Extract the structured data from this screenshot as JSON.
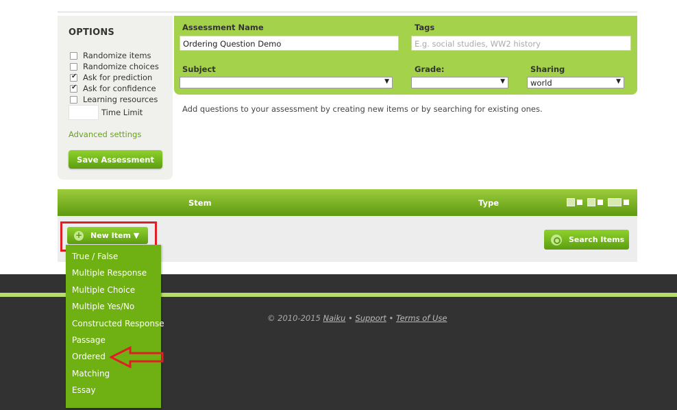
{
  "options": {
    "title": "OPTIONS",
    "items": [
      {
        "label": "Randomize items",
        "checked": false
      },
      {
        "label": "Randomize choices",
        "checked": false
      },
      {
        "label": "Ask for prediction",
        "checked": true
      },
      {
        "label": "Ask for confidence",
        "checked": true
      },
      {
        "label": "Learning resources",
        "checked": false
      }
    ],
    "time_limit_label": "Time Limit",
    "time_limit_value": "",
    "advanced_link": "Advanced settings",
    "save_label": "Save Assessment"
  },
  "form": {
    "name_label": "Assessment Name",
    "name_value": "Ordering Question Demo",
    "tags_label": "Tags",
    "tags_placeholder": "E.g. social studies, WW2 history",
    "subject_label": "Subject",
    "subject_value": "",
    "grade_label": "Grade:",
    "grade_value": "",
    "sharing_label": "Sharing",
    "sharing_value": "world"
  },
  "help_text": "Add questions to your assessment by creating new items or by searching for existing ones.",
  "table": {
    "col_stem": "Stem",
    "col_type": "Type"
  },
  "new_item": {
    "label": "New Item ▼",
    "menu": [
      "True / False",
      "Multiple Response",
      "Multiple Choice",
      "Multiple Yes/No",
      "Constructed Response",
      "Passage",
      "Ordered",
      "Matching",
      "Essay"
    ]
  },
  "search_label": "Search Items",
  "footer": {
    "copyright": "© 2010-2015",
    "naiku": "Naiku",
    "bullet": "•",
    "support": "Support",
    "terms": "Terms of Use"
  },
  "colors": {
    "accent_green": "#a4d24a",
    "button_green": "#6fb013",
    "annotation_red": "#e01e26",
    "footer_bg": "#323232"
  }
}
